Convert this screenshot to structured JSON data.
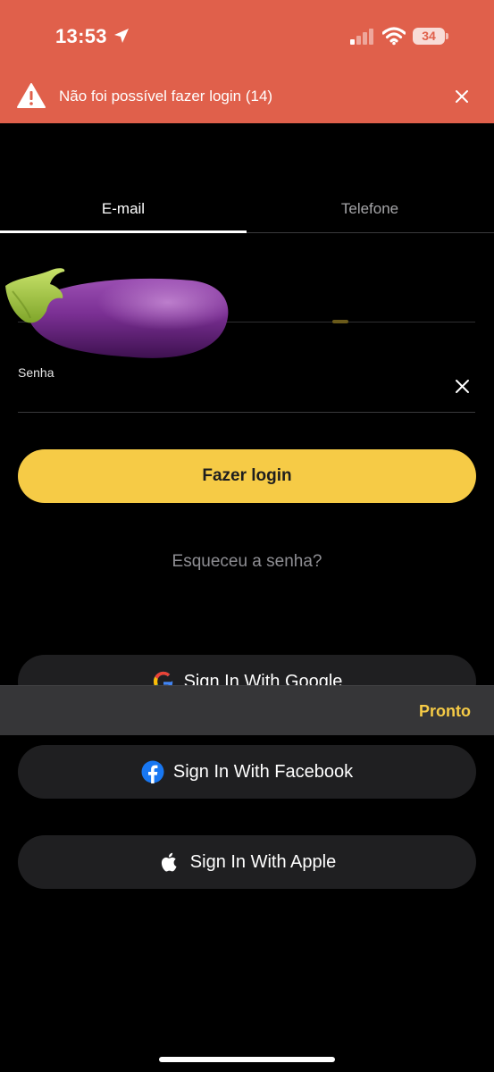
{
  "status_bar": {
    "time": "13:53",
    "battery": "34",
    "icons": [
      "location-arrow-icon",
      "cellular-signal-icon",
      "wifi-icon",
      "battery-icon"
    ]
  },
  "banner": {
    "message": "Não foi possível fazer login (14)",
    "background_color": "#e0604b",
    "icons": [
      "warning-icon",
      "close-icon"
    ]
  },
  "tabs": [
    {
      "label": "E-mail",
      "active": true
    },
    {
      "label": "Telefone",
      "active": false
    }
  ],
  "form": {
    "email_value": "",
    "password_label": "Senha",
    "password_value": "",
    "overlay_image": "eggplant-emoji"
  },
  "buttons": {
    "login": "Fazer login",
    "forgot_password": "Esqueceu a senha?",
    "google": "Sign In With Google",
    "facebook": "Sign In With Facebook",
    "apple": "Sign In With Apple"
  },
  "keyboard_accessory": {
    "done": "Pronto"
  },
  "colors": {
    "accent": "#f6cb46",
    "background": "#000000",
    "button_dark": "#1f1f21",
    "muted_text": "#8e8e93"
  }
}
